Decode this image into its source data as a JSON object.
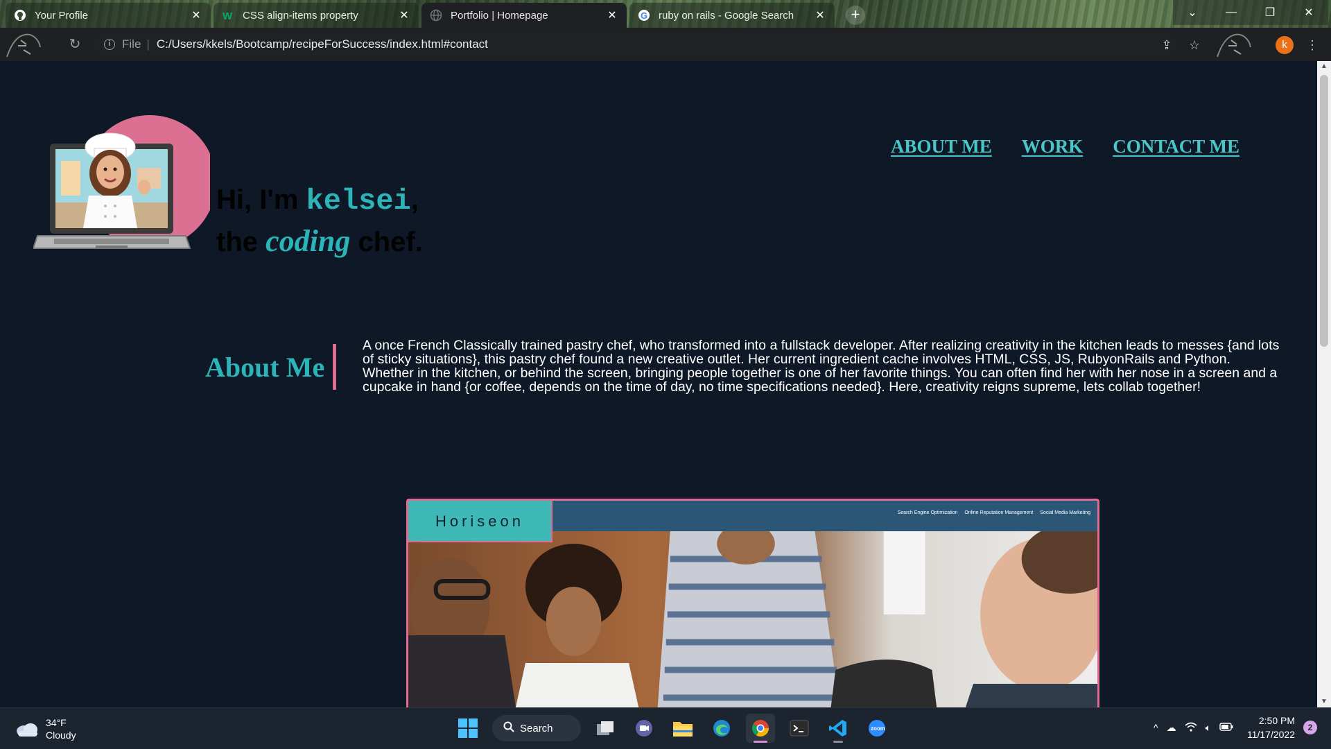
{
  "browser": {
    "tabs": [
      {
        "title": "Your Profile",
        "icon": "github-icon",
        "active": false
      },
      {
        "title": "CSS align-items property",
        "icon": "w3schools-icon",
        "active": false
      },
      {
        "title": "Portfolio | Homepage",
        "icon": "globe-icon",
        "active": true
      },
      {
        "title": "ruby on rails - Google Search",
        "icon": "google-icon",
        "active": false
      }
    ],
    "address": {
      "scheme": "File",
      "url": "C:/Users/kkels/Bootcamp/recipeForSuccess/index.html#contact"
    },
    "profile_initial": "k"
  },
  "page": {
    "hero": {
      "line1_prefix": "Hi, I'm ",
      "name": "kelsei",
      "line1_suffix": ",",
      "line2_prefix": "the ",
      "emphasis": "coding",
      "line2_suffix": " chef."
    },
    "nav": [
      "ABOUT ME",
      "WORK",
      "CONTACT ME"
    ],
    "about": {
      "title": "About Me",
      "body": "A once French Classically trained pastry chef, who transformed into a fullstack developer. After realizing creativity in the kitchen leads to messes {and lots of sticky situations}, this pastry chef found a new creative outlet. Her current ingredient cache involves HTML, CSS, JS, RubyonRails and Python. Whether in the kitchen, or behind the screen, bringing people together is one of her favorite things. You can often find her with her nose in a screen and a cupcake in hand {or coffee, depends on the time of day, no time specifications needed}. Here, creativity reigns supreme, lets collab together!"
    },
    "work": {
      "brand": "Horiseon",
      "links": [
        "Search Engine Optimization",
        "Online Reputation Management",
        "Social Media Marketing"
      ]
    }
  },
  "taskbar": {
    "weather": {
      "temp": "34°F",
      "condition": "Cloudy"
    },
    "search_label": "Search",
    "time": "2:50 PM",
    "date": "11/17/2022",
    "notifications": "2"
  },
  "colors": {
    "page_bg": "#0f1826",
    "accent_teal": "#2bb5b8",
    "accent_pink": "#e06c93"
  }
}
